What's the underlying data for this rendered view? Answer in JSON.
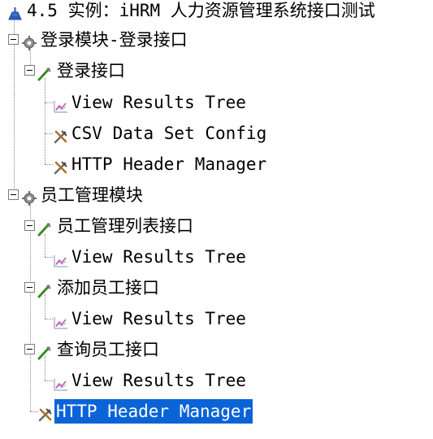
{
  "tree": {
    "root": {
      "label": "4.5  实例：iHRM 人力资源管理系统接口测试",
      "icon": "test-plan-icon"
    },
    "login_module": {
      "label": "登录模块-登录接口",
      "icon": "thread-group-icon"
    },
    "login_api": {
      "label": "登录接口",
      "icon": "http-sampler-icon"
    },
    "login_results": {
      "label": "View Results Tree",
      "icon": "listener-icon"
    },
    "login_csv": {
      "label": "CSV Data Set Config",
      "icon": "config-wrench-icon"
    },
    "login_header": {
      "label": "HTTP Header Manager",
      "icon": "config-wrench-icon"
    },
    "employee_module": {
      "label": "员工管理模块",
      "icon": "thread-group-icon"
    },
    "employee_list_api": {
      "label": "员工管理列表接口",
      "icon": "http-sampler-icon"
    },
    "employee_list_results": {
      "label": "View Results Tree",
      "icon": "listener-icon"
    },
    "add_employee_api": {
      "label": "添加员工接口",
      "icon": "http-sampler-icon"
    },
    "add_employee_results": {
      "label": "View Results Tree",
      "icon": "listener-icon"
    },
    "query_employee_api": {
      "label": "查询员工接口",
      "icon": "http-sampler-icon"
    },
    "query_employee_results": {
      "label": "View Results Tree",
      "icon": "listener-icon"
    },
    "employee_header": {
      "label": "HTTP Header Manager",
      "icon": "config-wrench-icon",
      "selected": true
    }
  },
  "colors": {
    "selection": "#0a64d8",
    "connector": "#888888"
  }
}
